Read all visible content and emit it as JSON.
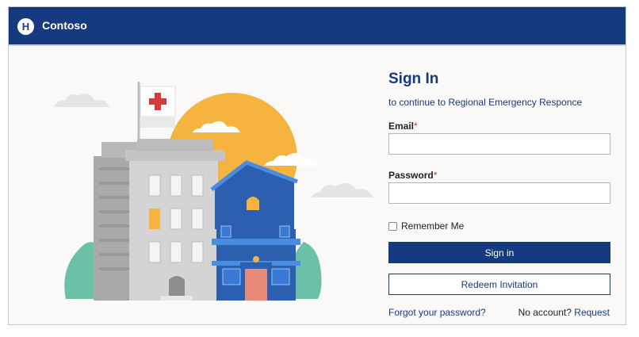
{
  "header": {
    "logo_letter": "H",
    "brand": "Contoso"
  },
  "signin": {
    "title": "Sign In",
    "subtitle": "to continue to Regional Emergency Responce",
    "email_label": "Email",
    "email_value": "",
    "password_label": "Password",
    "password_value": "",
    "required_mark": "*",
    "remember_label": "Remember Me",
    "signin_button": "Sign in",
    "redeem_button": "Redeem Invitation",
    "forgot_link": "Forgot your password?",
    "no_account_text": "No account?",
    "request_link": "Request"
  },
  "colors": {
    "brand_blue": "#153a7f",
    "required_red": "#c0392b"
  }
}
